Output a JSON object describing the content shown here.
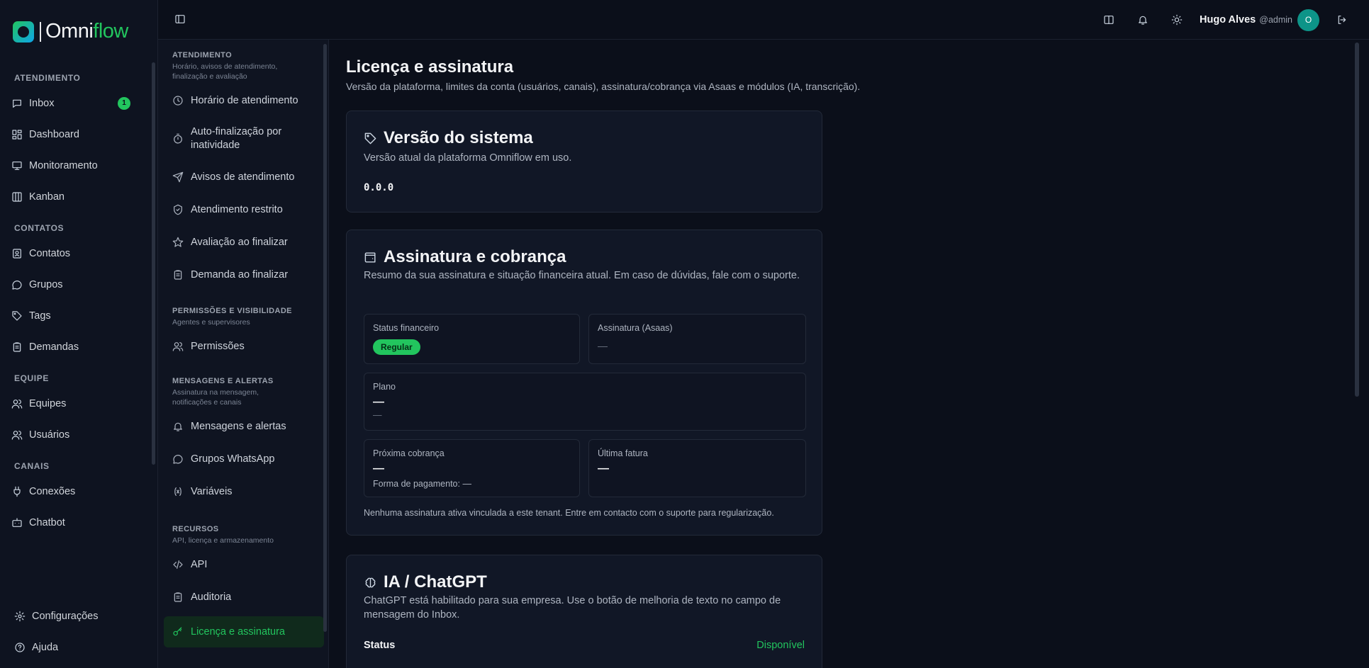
{
  "brand": {
    "name_part1": "Omni",
    "name_part2": "flow"
  },
  "sidebar": {
    "sections": [
      {
        "title": "ATENDIMENTO",
        "items": [
          {
            "label": "Inbox",
            "icon": "inbox-icon",
            "badge": "1"
          },
          {
            "label": "Dashboard",
            "icon": "dashboard-icon"
          },
          {
            "label": "Monitoramento",
            "icon": "monitor-icon"
          },
          {
            "label": "Kanban",
            "icon": "kanban-icon"
          }
        ]
      },
      {
        "title": "CONTATOS",
        "items": [
          {
            "label": "Contatos",
            "icon": "contacts-icon"
          },
          {
            "label": "Grupos",
            "icon": "chat-bubble-icon"
          },
          {
            "label": "Tags",
            "icon": "tag-icon"
          },
          {
            "label": "Demandas",
            "icon": "clipboard-icon"
          }
        ]
      },
      {
        "title": "EQUIPE",
        "items": [
          {
            "label": "Equipes",
            "icon": "users-icon"
          },
          {
            "label": "Usuários",
            "icon": "users-icon"
          }
        ]
      },
      {
        "title": "CANAIS",
        "items": [
          {
            "label": "Conexões",
            "icon": "plug-icon"
          },
          {
            "label": "Chatbot",
            "icon": "bot-icon"
          }
        ]
      }
    ],
    "bottom": [
      {
        "label": "Configurações",
        "icon": "gear-icon"
      },
      {
        "label": "Ajuda",
        "icon": "help-icon"
      }
    ]
  },
  "settings_nav": {
    "atendimento": {
      "title": "ATENDIMENTO",
      "desc": "Horário, avisos de atendimento, finalização e avaliação",
      "items": [
        "Horário de atendimento",
        "Auto-finalização por inatividade",
        "Avisos de atendimento",
        "Atendimento restrito",
        "Avaliação ao finalizar",
        "Demanda ao finalizar"
      ]
    },
    "permissoes": {
      "title": "PERMISSÕES E VISIBILIDADE",
      "desc": "Agentes e supervisores",
      "items": [
        "Permissões"
      ]
    },
    "mensagens": {
      "title": "MENSAGENS E ALERTAS",
      "desc": "Assinatura na mensagem, notificações e canais",
      "items": [
        "Mensagens e alertas",
        "Grupos WhatsApp",
        "Variáveis"
      ]
    },
    "recursos": {
      "title": "RECURSOS",
      "desc": "API, licença e armazenamento",
      "items": [
        "API",
        "Auditoria",
        "Licença e assinatura"
      ]
    }
  },
  "topbar": {
    "user_name": "Hugo Alves",
    "user_handle": "@admin",
    "avatar_initial": "O"
  },
  "page": {
    "title": "Licença e assinatura",
    "subtitle": "Versão da plataforma, limites da conta (usuários, canais), assinatura/cobrança via Asaas e módulos (IA, transcrição)."
  },
  "version_card": {
    "title": "Versão do sistema",
    "desc": "Versão atual da plataforma Omniflow em uso.",
    "version": "0.0.0"
  },
  "billing_card": {
    "title": "Assinatura e cobrança",
    "desc": "Resumo da sua assinatura e situação financeira atual. Em caso de dúvidas, fale com o suporte.",
    "status_label": "Status financeiro",
    "status_value": "Regular",
    "subscription_label": "Assinatura (Asaas)",
    "subscription_value": "—",
    "plan_label": "Plano",
    "plan_value": "—",
    "plan_detail": "—",
    "next_label": "Próxima cobrança",
    "next_value": "—",
    "payment_method": "Forma de pagamento: —",
    "invoice_label": "Última fatura",
    "invoice_value": "—",
    "footnote": "Nenhuma assinatura ativa vinculada a este tenant. Entre em contacto com o suporte para regularização."
  },
  "ai_card": {
    "title": "IA / ChatGPT",
    "desc": "ChatGPT está habilitado para sua empresa. Use o botão de melhoria de texto no campo de mensagem do Inbox.",
    "status_label": "Status",
    "status_value": "Disponível"
  },
  "colors": {
    "accent": "#22c55e",
    "background": "#0b0f1a",
    "card": "#111726"
  }
}
